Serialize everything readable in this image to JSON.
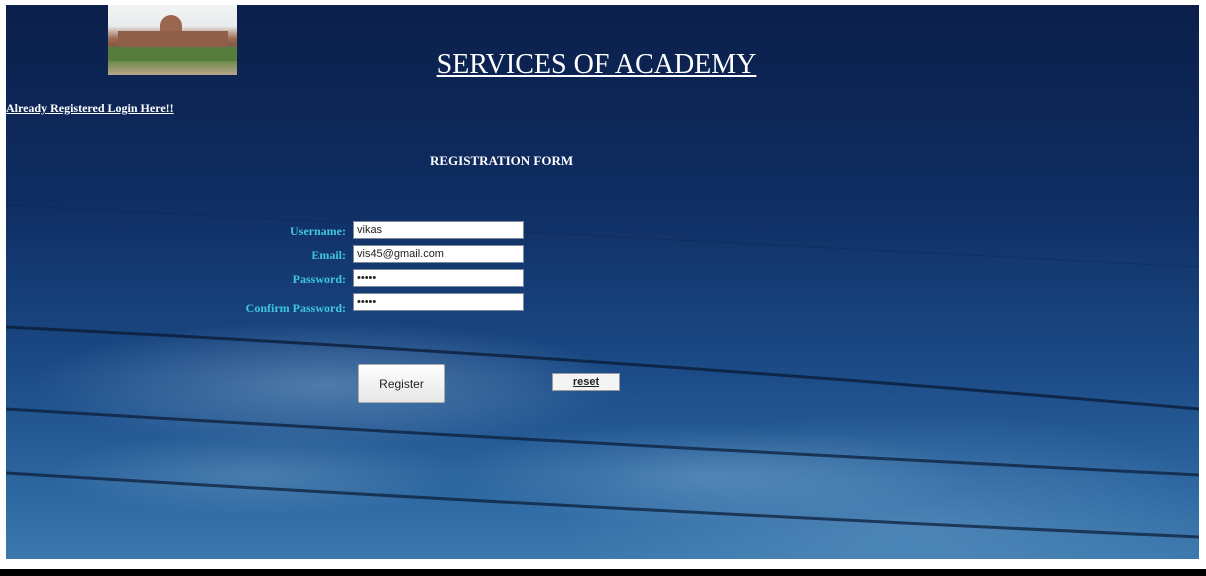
{
  "header": {
    "title": "SERVICES OF ACADEMY",
    "login_link": "Already Registered Login Here!!",
    "logo": "academy-building-photo"
  },
  "form": {
    "heading": "REGISTRATION FORM",
    "fields": [
      {
        "label": "Username:",
        "value": "vikas",
        "type": "text"
      },
      {
        "label": "Email:",
        "value": "vis45@gmail.com",
        "type": "text"
      },
      {
        "label": "Password:",
        "value": "vikas",
        "type": "password"
      },
      {
        "label": "Confirm Password:",
        "value": "vikas",
        "type": "password"
      }
    ],
    "register_label": "Register",
    "reset_label": "reset"
  },
  "colors": {
    "label": "#3fc7e0",
    "background_top": "#0b1f4a",
    "background_bottom": "#3c78ad"
  }
}
